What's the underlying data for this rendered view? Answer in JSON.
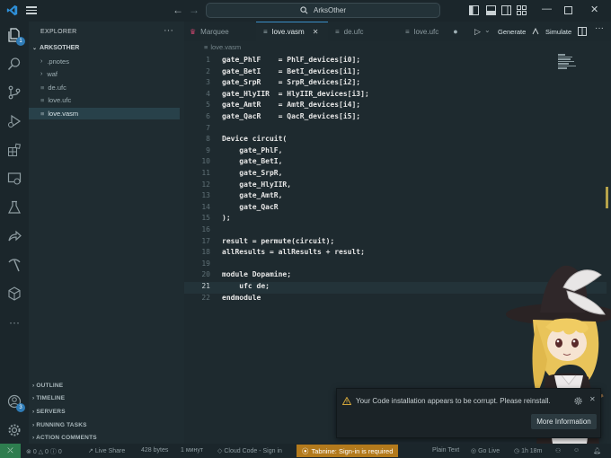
{
  "titlebar": {
    "search_text": "ArksOther",
    "colors": {
      "logo": "#2e8fd8"
    }
  },
  "activity": {
    "explorer_badge": "1",
    "accounts_badge": "3"
  },
  "sidebar": {
    "title": "EXPLORER",
    "root": "ARKSOTHER",
    "items": [
      {
        "label": ".pnotes",
        "kind": "folder"
      },
      {
        "label": "waf",
        "kind": "folder"
      },
      {
        "label": "de.ufc",
        "kind": "file"
      },
      {
        "label": "love.ufc",
        "kind": "file"
      },
      {
        "label": "love.vasm",
        "kind": "file",
        "active": true
      }
    ],
    "panels": [
      "OUTLINE",
      "TIMELINE",
      "SERVERS",
      "RUNNING TASKS",
      "ACTION COMMENTS"
    ]
  },
  "tabs": [
    {
      "label": "Marquee",
      "icon": "crown-icon"
    },
    {
      "label": "love.vasm",
      "icon": "file-lines-icon",
      "active": true
    },
    {
      "label": "de.ufc",
      "icon": "file-lines-icon"
    },
    {
      "label": "love.ufc",
      "icon": "file-lines-icon",
      "modified": true
    }
  ],
  "toolbar": {
    "generate": "Generate",
    "simulate": "Simulate"
  },
  "breadcrumb": "love.vasm",
  "editor": {
    "lines": [
      "gate_PhlF    = PhlF_devices[i0];",
      "gate_BetI    = BetI_devices[i1];",
      "gate_SrpR    = SrpR_devices[i2];",
      "gate_HlyIIR  = HlyIIR_devices[i3];",
      "gate_AmtR    = AmtR_devices[i4];",
      "gate_QacR    = QacR_devices[i5];",
      "",
      "Device circuit(",
      "    gate_PhlF,",
      "    gate_BetI,",
      "    gate_SrpR,",
      "    gate_HlyIIR,",
      "    gate_AmtR,",
      "    gate_QacR",
      ");",
      "",
      "result = permute(circuit);",
      "allResults = allResults + result;",
      "",
      "module Dopamine;",
      "    ufc de;",
      "endmodule"
    ],
    "current_line": 21
  },
  "notification": {
    "message": "Your Code installation appears to be corrupt. Please reinstall.",
    "button": "More Information"
  },
  "status": {
    "errors": "0",
    "warnings": "0",
    "info": "0",
    "live_share": "Live Share",
    "bytes": "428 bytes",
    "time": "1 минут",
    "cloud_code": "Cloud Code - Sign in",
    "tabnine": "Tabnine: Sign-in is required",
    "language": "Plain Text",
    "go_live": "Go Live",
    "timer": "1h 18m"
  }
}
